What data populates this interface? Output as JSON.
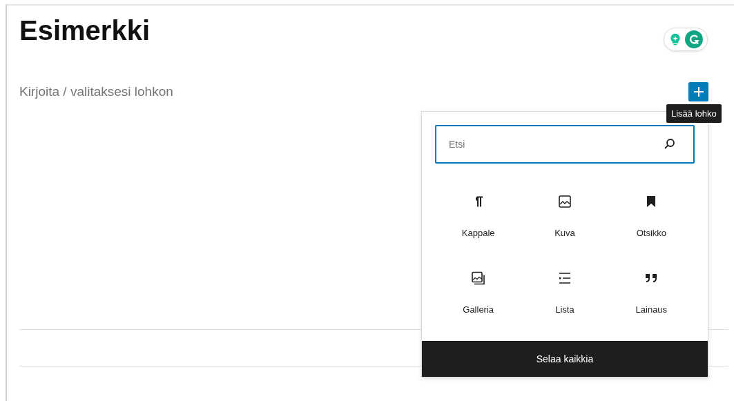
{
  "post_title": "Esimerkki",
  "block_placeholder": "Kirjoita / valitaksesi lohkon",
  "add_block_tooltip": "Lisää lohko",
  "inserter": {
    "search": {
      "placeholder": "Etsi"
    },
    "blocks": [
      {
        "label": "Kappale",
        "kind": "paragraph"
      },
      {
        "label": "Kuva",
        "kind": "image"
      },
      {
        "label": "Otsikko",
        "kind": "heading"
      },
      {
        "label": "Galleria",
        "kind": "gallery"
      },
      {
        "label": "Lista",
        "kind": "list"
      },
      {
        "label": "Lainaus",
        "kind": "quote"
      }
    ],
    "browse_all": "Selaa kaikkia"
  }
}
